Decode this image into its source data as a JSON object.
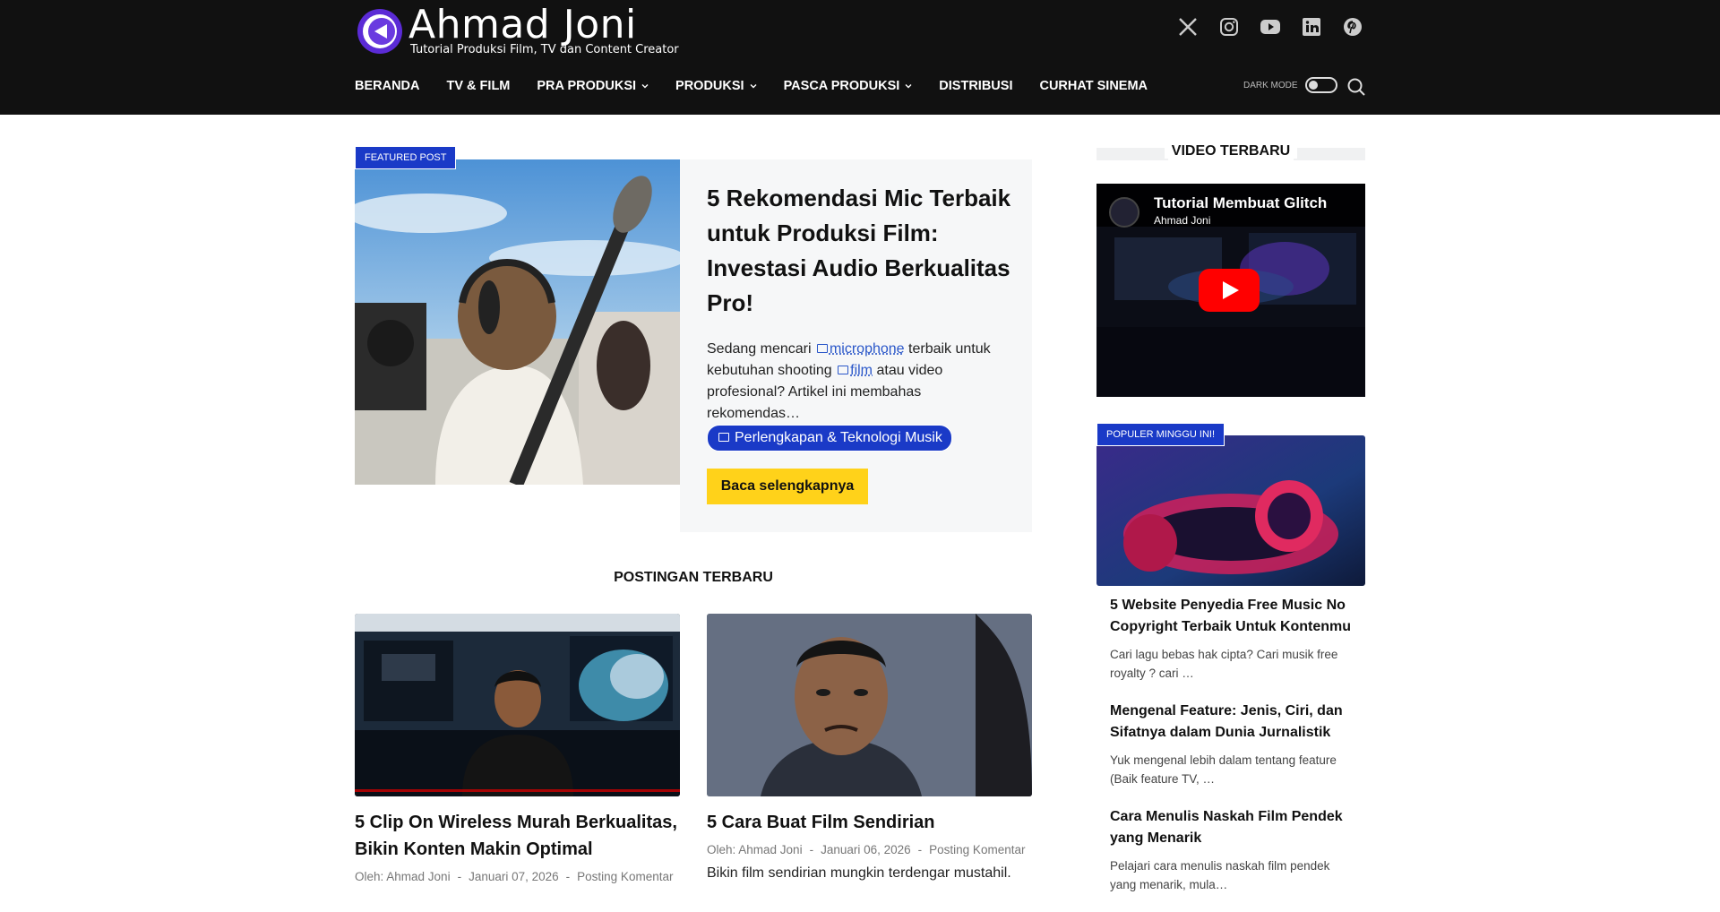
{
  "header": {
    "logo_title": "Ahmad Joni",
    "logo_subtitle": "Tutorial Produksi Film, TV dan Content Creator",
    "socials": [
      "x-icon",
      "instagram-icon",
      "youtube-icon",
      "linkedin-icon",
      "pinterest-icon"
    ],
    "nav": [
      {
        "label": "BERANDA",
        "dropdown": false
      },
      {
        "label": "TV & FILM",
        "dropdown": false
      },
      {
        "label": "PRA PRODUKSI",
        "dropdown": true
      },
      {
        "label": "PRODUKSI",
        "dropdown": true
      },
      {
        "label": "PASCA PRODUKSI",
        "dropdown": true
      },
      {
        "label": "DISTRIBUSI",
        "dropdown": false
      },
      {
        "label": "CURHAT SINEMA",
        "dropdown": false
      }
    ],
    "dark_mode_label": "DARK MODE"
  },
  "featured": {
    "badge": "FEATURED POST",
    "title": "5 Rekomendasi Mic Terbaik untuk Produksi Film: Investasi Audio Berkualitas Pro!",
    "excerpt_1": "Sedang mencari",
    "link_1": "microphone",
    "excerpt_2": "terbaik untuk kebutuhan shooting",
    "link_2": "film",
    "excerpt_3": "atau video profesional? Artikel ini membahas rekomendas…",
    "tag": "Perlengkapan & Teknologi Musik",
    "read_more": "Baca selengkapnya"
  },
  "latest": {
    "title": "POSTINGAN TERBARU",
    "posts": [
      {
        "title": "5 Clip On Wireless Murah Berkualitas, Bikin Konten Makin Optimal",
        "author": "Oleh: Ahmad Joni",
        "date": "Januari 07, 2026",
        "comments": "Posting Komentar",
        "excerpt": ""
      },
      {
        "title": "5 Cara Buat Film Sendirian",
        "author": "Oleh: Ahmad Joni",
        "date": "Januari 06, 2026",
        "comments": "Posting Komentar",
        "excerpt": "Bikin film sendirian mungkin terdengar mustahil."
      }
    ],
    "separator": "-"
  },
  "sidebar": {
    "video_heading": "VIDEO TERBARU",
    "video_title": "Tutorial Membuat Glitch",
    "video_channel": "Ahmad Joni",
    "popular_badge": "POPULER MINGGU INI!",
    "popular": [
      {
        "title": "5 Website Penyedia Free Music No Copyright Terbaik Untuk Kontenmu",
        "excerpt": "Cari lagu bebas hak cipta? Cari musik free royalty ? cari …"
      },
      {
        "title": "Mengenal Feature: Jenis, Ciri, dan Sifatnya dalam Dunia Jurnalistik",
        "excerpt": "Yuk mengenal lebih dalam tentang feature (Baik feature TV, …"
      },
      {
        "title": "Cara Menulis Naskah Film Pendek yang Menarik",
        "excerpt": "Pelajari cara menulis naskah film pendek yang menarik, mula…"
      }
    ]
  },
  "colors": {
    "header_bg": "#111111",
    "accent_blue": "#1a3ac7",
    "accent_yellow": "#ffd21a",
    "link_blue": "#2a57c9"
  }
}
